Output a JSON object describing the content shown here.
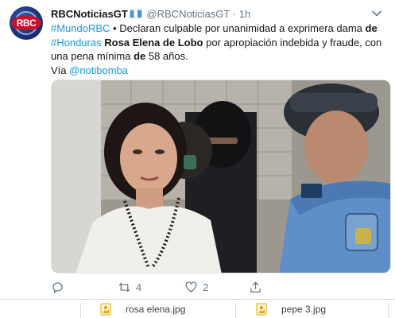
{
  "tweet": {
    "avatar_text": "RBC",
    "display_name": "RBCNoticiasGT",
    "handle": "@RBCNoticiasGT",
    "dot": "·",
    "time": "1h",
    "text": {
      "hashtag1": "#MundoRBC",
      "part1": " • Declaran culpable por unanimidad a exprimera dama ",
      "de1": "de",
      "hashtag2": "#Honduras",
      "name": "Rosa Elena de Lobo",
      "part2": " por apropiación indebida y fraude, con una pena mínima ",
      "de2": "de",
      "part3": " 58 años.",
      "via": "Vía ",
      "mention": "@notibomba"
    },
    "actions": {
      "reply_count": "",
      "retweet_count": "4",
      "like_count": "2"
    }
  },
  "downloads": [
    {
      "name": "rosa elena.jpg"
    },
    {
      "name": "pepe 3.jpg"
    }
  ],
  "colors": {
    "link": "#1b95e0",
    "secondary": "#657786",
    "text": "#14171a"
  }
}
